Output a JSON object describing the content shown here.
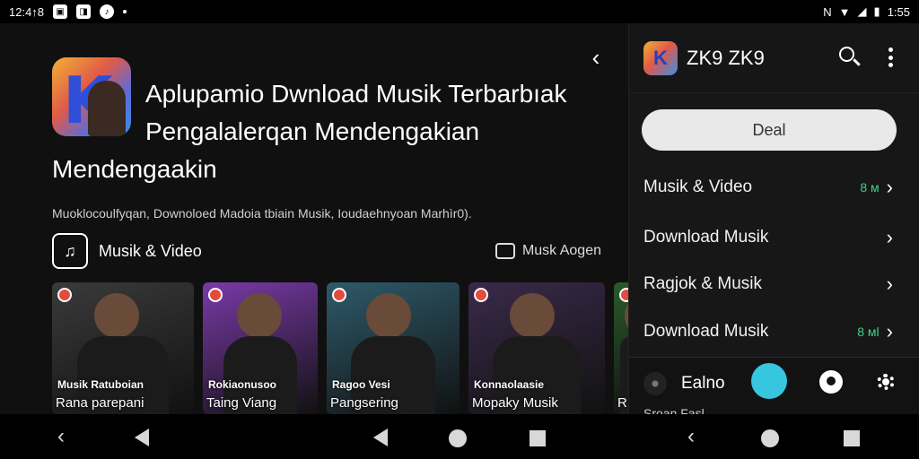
{
  "status_bar": {
    "time_left": "12:4↑8",
    "time_right": "1:55",
    "left_icons": [
      "image-icon",
      "photo-icon",
      "music-icon",
      "dot-icon"
    ],
    "right_icons": [
      "nfc-icon",
      "wifi-icon",
      "signal-icon",
      "battery-icon"
    ]
  },
  "app": {
    "title_line1": "Aplupamio Dwnload Musik Terbarbıak",
    "title_line2": "Pengalalerqan Mendengakian",
    "title_line3": "Mendengaakin",
    "description": "Muoklocoulfyqan, Downoloed Madoia tbiain Musik, Ioudaehnyoan Marhìr0).",
    "category_label": "Musik & Video",
    "more_label": "Musk Aogen"
  },
  "cards": [
    {
      "caption_top": "Musik Ratuboian",
      "caption_bottom": "Rana parepani",
      "bg": "#3a3a3a"
    },
    {
      "caption_top": "Rokiaonusoo",
      "caption_bottom": "Taing Viang",
      "bg": "#7a3aa8"
    },
    {
      "caption_top": "Ragoo Vesi",
      "caption_bottom": "Pangsering",
      "bg": "#2e5a6a"
    },
    {
      "caption_top": "Konnaolaasie",
      "caption_bottom": "Mopaky Musik",
      "bg": "#3a2a4a"
    },
    {
      "caption_top": "",
      "caption_bottom": "R",
      "bg": "#2a5a2a"
    }
  ],
  "drawer": {
    "title": "ZK9 ZK9",
    "deal_label": "Deal",
    "menu": [
      {
        "label": "Musik & Video",
        "count": "8 ᴍ"
      },
      {
        "label": "Download Musik",
        "count": ""
      },
      {
        "label": "Ragjok & Musik",
        "count": ""
      },
      {
        "label": "Download Musik",
        "count": "8 ᴍl"
      }
    ],
    "player_title": "Ealno",
    "player_sub": "Sroan Fasl",
    "accent": "#37c6e0"
  }
}
